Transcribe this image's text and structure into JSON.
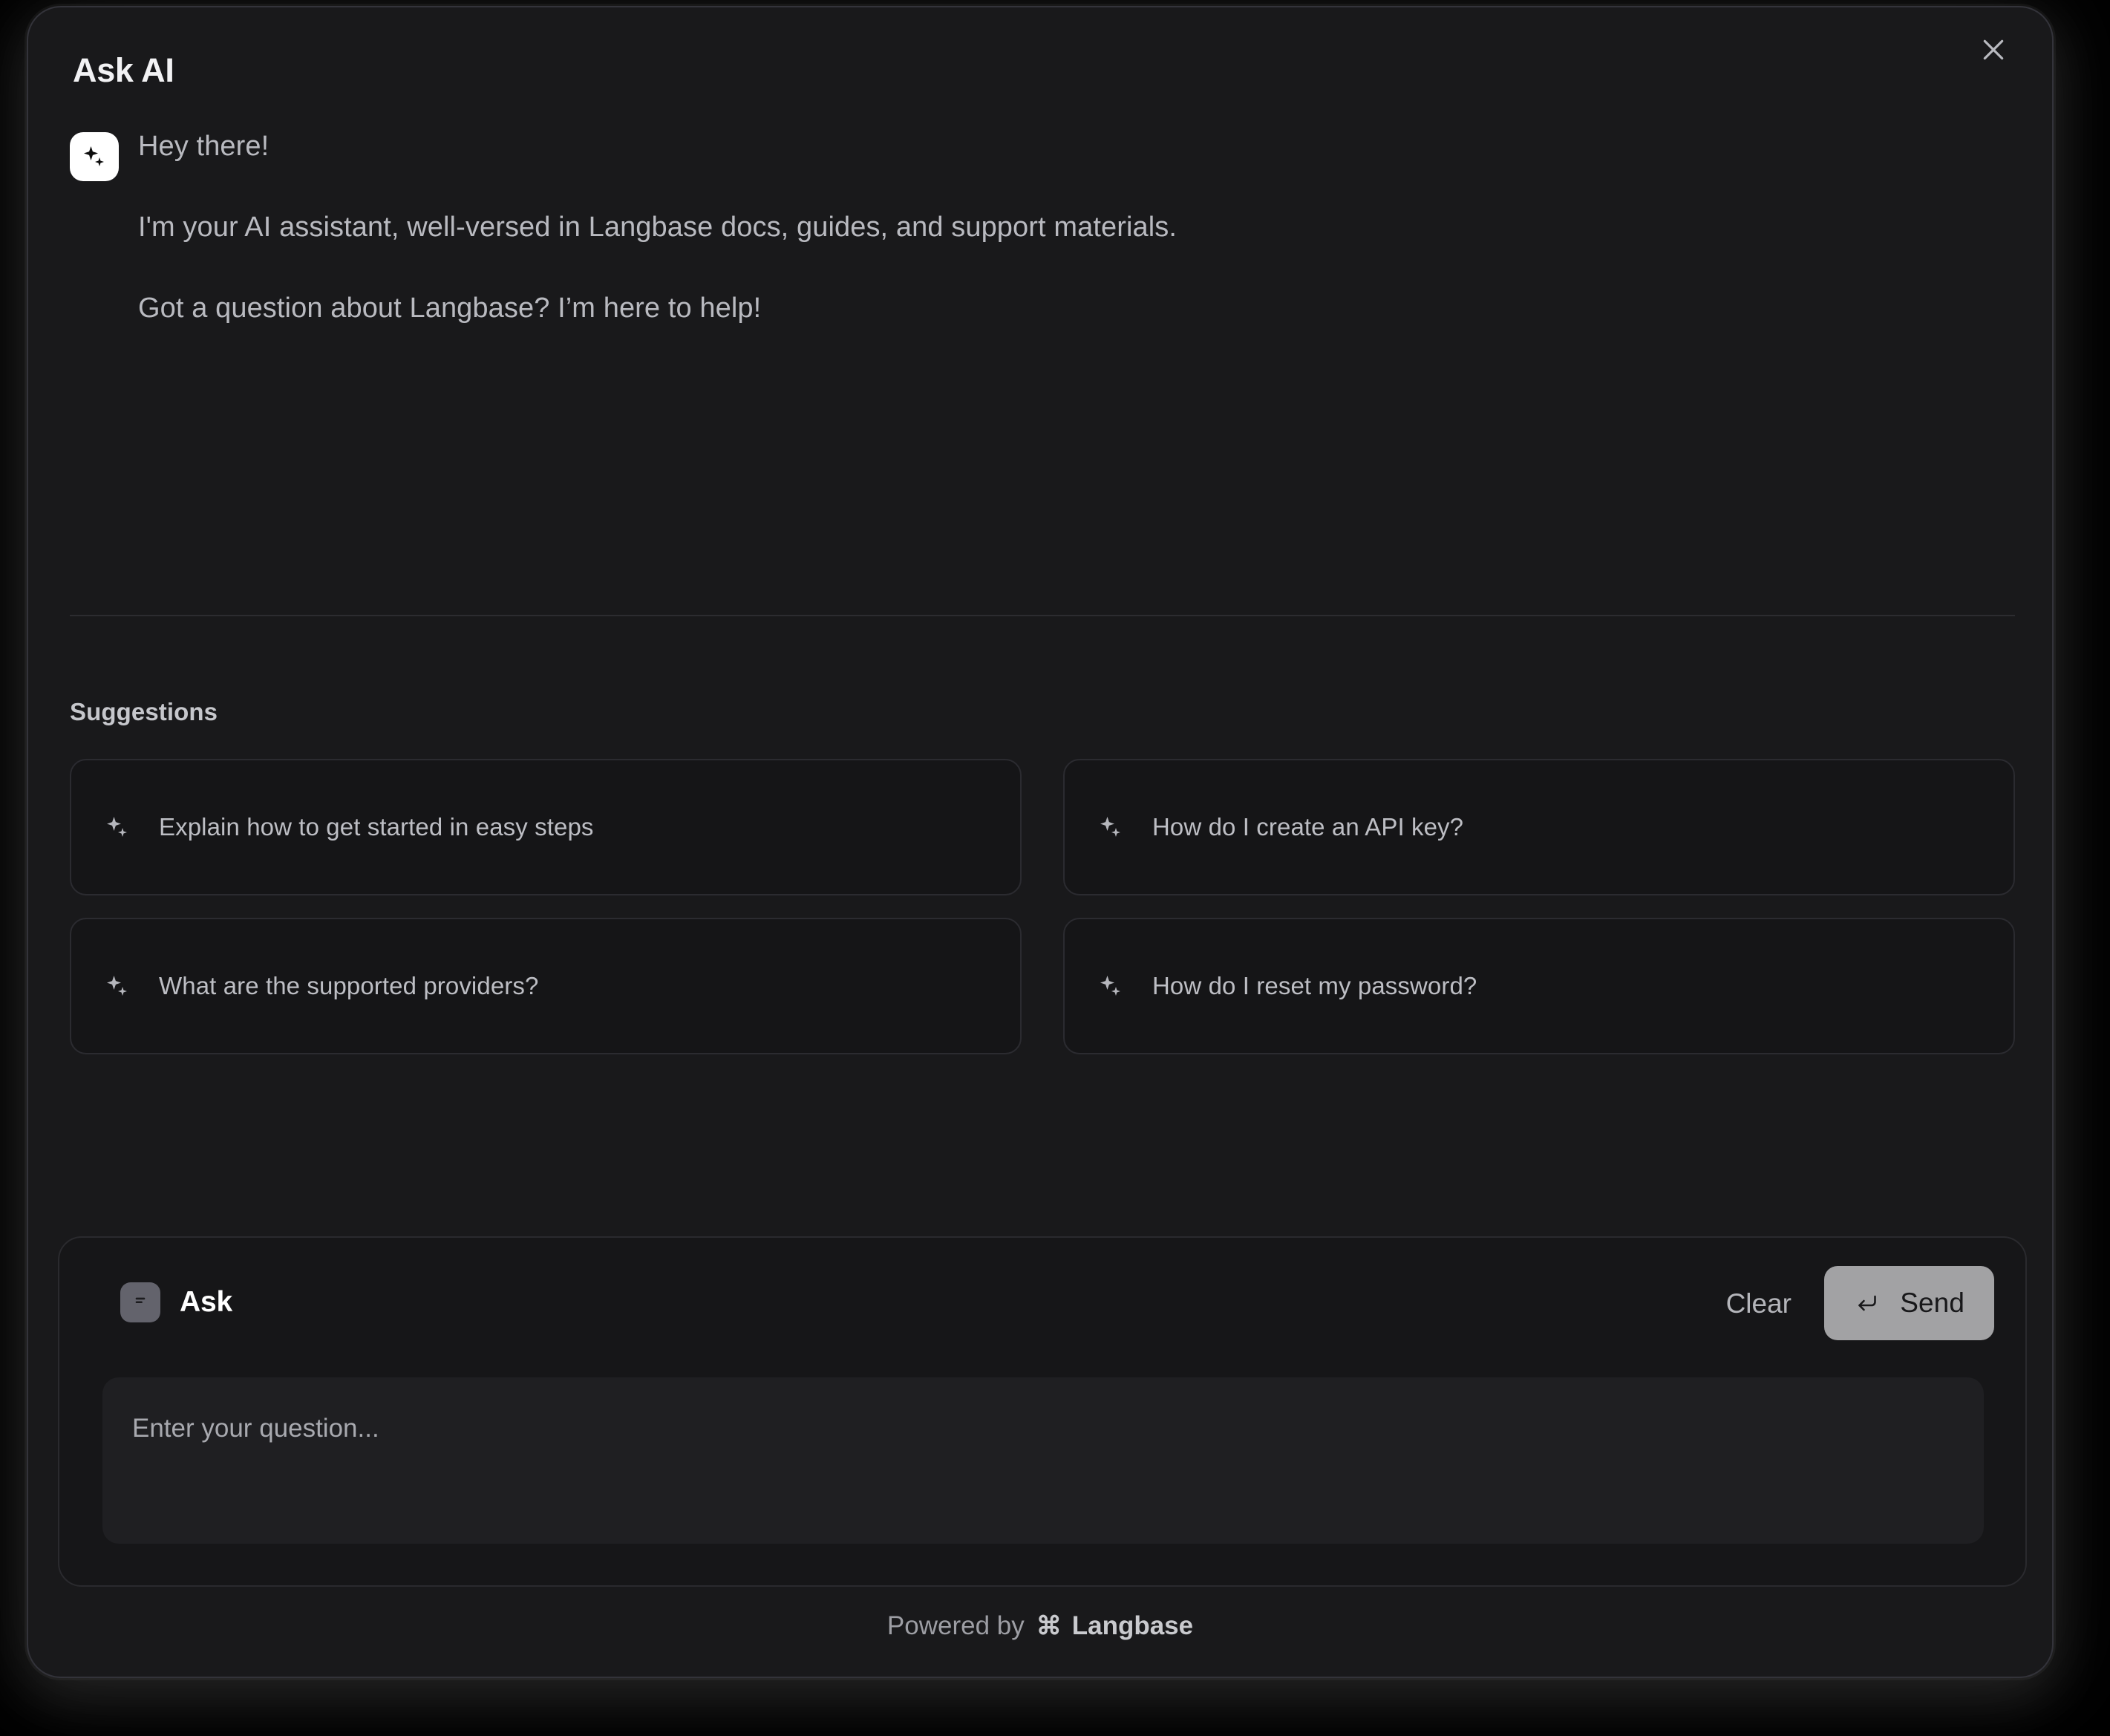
{
  "dialog": {
    "title": "Ask AI",
    "close_icon": "close-icon",
    "close_label": "Close"
  },
  "greeting": {
    "avatar_icon": "sparkles-icon",
    "lines": [
      "Hey there!",
      "I'm your AI assistant, well-versed in Langbase docs, guides, and support materials.",
      "Got a question about Langbase? I’m here to help!"
    ]
  },
  "suggestions": {
    "heading": "Suggestions",
    "icon": "sparkles-icon",
    "items": [
      {
        "label": "Explain how to get started in easy steps"
      },
      {
        "label": "How do I create an API key?"
      },
      {
        "label": "What are the supported providers?"
      },
      {
        "label": "How do I reset my password?"
      }
    ]
  },
  "composer": {
    "icon": "message-square-icon",
    "label": "Ask",
    "clear_label": "Clear",
    "send_label": "Send",
    "send_icon": "enter-return-icon",
    "input_value": "",
    "input_placeholder": "Enter your question..."
  },
  "footer": {
    "powered_by": "Powered by",
    "brand_glyph": "⌘",
    "brand": "Langbase"
  },
  "colors": {
    "page_background": "#000000",
    "dialog_background": "#19191b",
    "dialog_border": "#33333a",
    "card_background": "#151517",
    "card_border": "#2b2b30",
    "composer_background": "#161618",
    "input_background": "#1f1f22",
    "send_button_background": "#a2a2a4",
    "send_button_text": "#18181a",
    "title_text": "#f2f2f4",
    "body_text": "#b9bac0",
    "muted_text": "#9d9ea4",
    "avatar_background": "#ffffff",
    "ask_icon_background": "#63636c",
    "divider": "#2c2c30"
  }
}
